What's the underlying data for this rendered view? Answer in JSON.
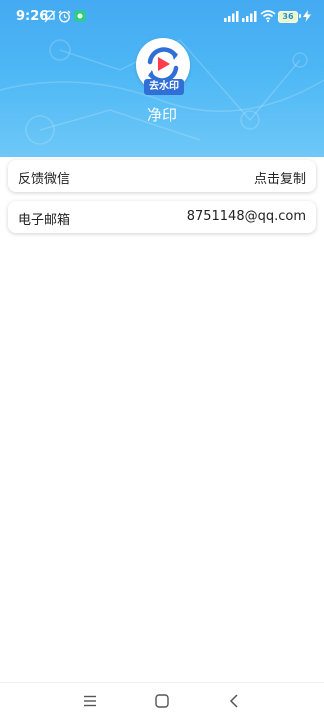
{
  "status_bar": {
    "time": "9:26",
    "battery": "36"
  },
  "header": {
    "logo_badge": "去水印",
    "app_name": "净印"
  },
  "items": [
    {
      "label": "反馈微信",
      "value": "点击复制"
    },
    {
      "label": "电子邮箱",
      "value": "8751148@qq.com"
    }
  ],
  "colors": {
    "header_top": "#44aaf2",
    "header_bottom": "#6ec8f7",
    "logo_blue": "#2f6fd6",
    "logo_red": "#ff3b4e"
  }
}
